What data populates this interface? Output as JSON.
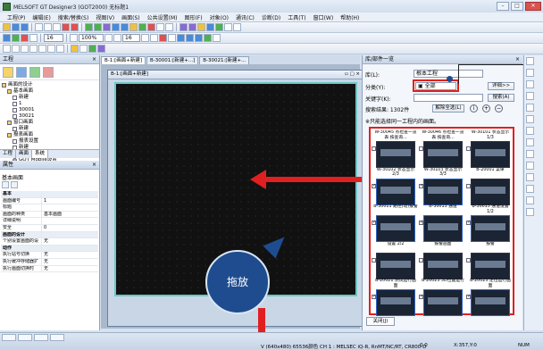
{
  "window": {
    "title": "MELSOFT GT Designer3 (GOT2000) 无标题1",
    "minimize": "–",
    "restore": "□",
    "close": "✕"
  },
  "menu": [
    "工程(P)",
    "编辑(E)",
    "搜索/替换(S)",
    "视图(V)",
    "画面(S)",
    "公共设置(M)",
    "图形(F)",
    "对象(O)",
    "通讯(C)",
    "诊断(D)",
    "工具(T)",
    "窗口(W)",
    "帮助(H)"
  ],
  "toolbar": {
    "font_size": "16",
    "zoom": "100%",
    "grid": "16"
  },
  "project_panel": {
    "title": "工程",
    "close": "×",
    "tree": [
      {
        "label": "画面的设计",
        "indent": 0,
        "icon": "folder"
      },
      {
        "label": "基本画面",
        "indent": 1,
        "icon": "folder"
      },
      {
        "label": "新建",
        "indent": 2,
        "icon": "doc"
      },
      {
        "label": "1",
        "indent": 2,
        "icon": "doc"
      },
      {
        "label": "30001",
        "indent": 2,
        "icon": "doc"
      },
      {
        "label": "30021",
        "indent": 2,
        "icon": "doc"
      },
      {
        "label": "窗口画面",
        "indent": 1,
        "icon": "folder"
      },
      {
        "label": "新建",
        "indent": 2,
        "icon": "doc"
      },
      {
        "label": "报表画面",
        "indent": 1,
        "icon": "folder"
      },
      {
        "label": "报表设置",
        "indent": 2,
        "icon": "doc"
      },
      {
        "label": "新建",
        "indent": 2,
        "icon": "doc"
      },
      {
        "label": "移动画面",
        "indent": 1,
        "icon": "folder"
      },
      {
        "label": "GOT Mobile设置",
        "indent": 2,
        "icon": "gear"
      },
      {
        "label": "新建",
        "indent": 2,
        "icon": "doc"
      }
    ],
    "tabs": [
      "工程",
      "画面",
      "系统"
    ]
  },
  "properties": {
    "title": "属性",
    "close": "×",
    "section": "基本画面",
    "rows": [
      {
        "k": "基本",
        "v": "",
        "group": true
      },
      {
        "k": "画面编号",
        "v": "1"
      },
      {
        "k": "标题",
        "v": ""
      },
      {
        "k": "画面的种类",
        "v": "基本画面"
      },
      {
        "k": "详细说明",
        "v": ""
      },
      {
        "k": "安全",
        "v": "0"
      },
      {
        "k": "画面的设计",
        "v": "",
        "group": true
      },
      {
        "k": "个别设置画面的设",
        "v": "无"
      },
      {
        "k": "动作",
        "v": "",
        "group": true
      },
      {
        "k": "执行站号切换",
        "v": "无"
      },
      {
        "k": "执行缓冲存储器扩",
        "v": "无"
      },
      {
        "k": "执行画面切换时",
        "v": "无"
      }
    ]
  },
  "editor": {
    "tabs": [
      "B-1:[画面+新建]",
      "B-30001:[新建+...]",
      "B-30021:[新建+..."
    ],
    "subwindow_title": "B-1:[画面+新建]",
    "drop_label": "拖放"
  },
  "library": {
    "title": "库/部件一览",
    "close": "×",
    "library_label": "库(L):",
    "library_value": "根本工程",
    "category_label": "分类(Y):",
    "category_value": "全部",
    "detail_button": "详细>>",
    "keyword_label": "关键字(K):",
    "search_button": "搜索(A)",
    "result_label": "搜索结果: 1302件",
    "clear_button": "解除全选(L)",
    "note": "※只能选择同一工程内的画面。",
    "thumbnails": [
      {
        "label": "W-30045 点检查一览表 按查询...",
        "checked": false
      },
      {
        "label": "W-30046 点检查一览表 按查询...",
        "checked": false
      },
      {
        "label": "W-30101 状态显示 1/3",
        "checked": false
      },
      {
        "label": "W-30102 状态显示 2/3",
        "checked": true
      },
      {
        "label": "W-30103 状态显示 3/3",
        "checked": true
      },
      {
        "label": "B-20001 菜单",
        "checked": false
      },
      {
        "label": "B-30011 路径(动)报警",
        "checked": true
      },
      {
        "label": "B-30013 通道",
        "checked": true
      },
      {
        "label": "B-30015 通道设置 1/2",
        "checked": true
      },
      {
        "label": "设置 2/2",
        "checked": false
      },
      {
        "label": "报警画面",
        "checked": false
      },
      {
        "label": "报警",
        "checked": false
      },
      {
        "label": "B-20021 测试运行画面",
        "checked": true
      },
      {
        "label": "B-20023 3D位置运行",
        "checked": true
      },
      {
        "label": "B-20025 定位运行画面",
        "checked": true
      }
    ],
    "footer_button": "关闭(J)"
  },
  "status": {
    "device": "V (640x480)  65536颜色  CH 1 : MELSEC iQ-R, RnMT/NC/RT, CR800-D",
    "zoom_val": "0.0",
    "coords": "X:357,Y:0",
    "num": "NUM"
  },
  "colors": {
    "highlight_red": "#e02020",
    "callout_blue": "#1e4c8f",
    "canvas_border": "#6cc7c7"
  }
}
